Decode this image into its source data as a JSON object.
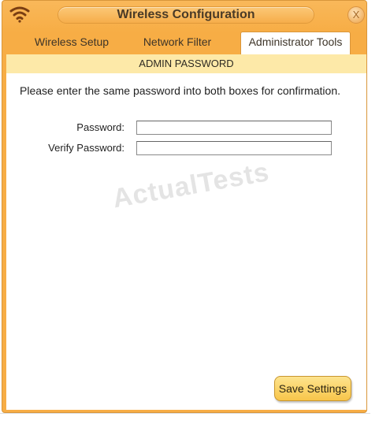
{
  "window": {
    "title": "Wireless Configuration",
    "close_label": "X"
  },
  "tabs": [
    {
      "label": "Wireless Setup",
      "active": false
    },
    {
      "label": "Network Filter",
      "active": false
    },
    {
      "label": "Administrator Tools",
      "active": true
    }
  ],
  "section": {
    "header": "ADMIN PASSWORD",
    "instruction": "Please enter the same password into both boxes for confirmation."
  },
  "form": {
    "password_label": "Password:",
    "password_value": "",
    "verify_label": "Verify Password:",
    "verify_value": ""
  },
  "watermark": "ActualTests",
  "actions": {
    "save_label": "Save Settings"
  },
  "colors": {
    "frame": "#f7ad45",
    "section_header_bg": "#fde9a8",
    "save_button": "#f8c54a"
  },
  "icons": {
    "app": "wifi-icon",
    "close": "close-icon"
  }
}
